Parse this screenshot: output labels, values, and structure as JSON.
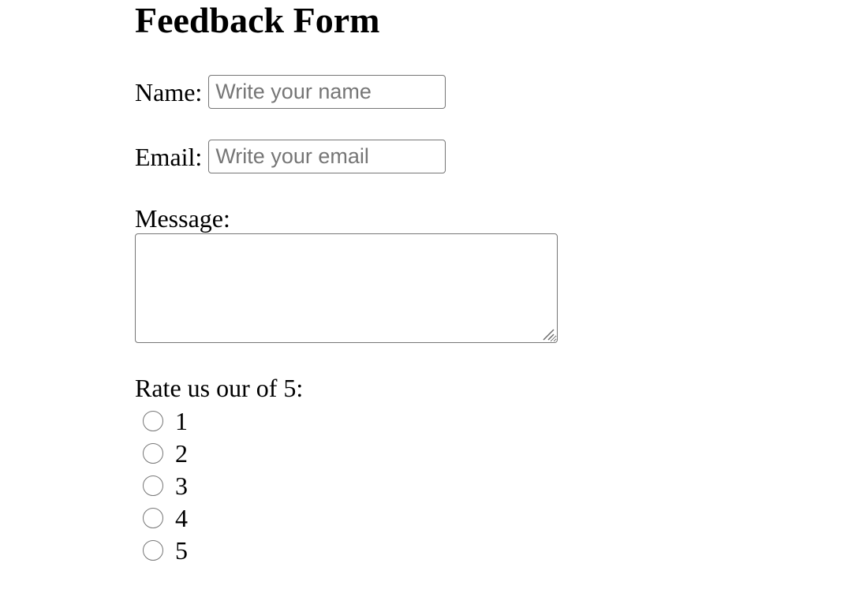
{
  "form": {
    "title": "Feedback Form",
    "name": {
      "label": "Name:",
      "placeholder": "Write your name",
      "value": ""
    },
    "email": {
      "label": "Email:",
      "placeholder": "Write your email",
      "value": ""
    },
    "message": {
      "label": "Message:",
      "value": ""
    },
    "rating": {
      "label": "Rate us our of 5:",
      "options": [
        "1",
        "2",
        "3",
        "4",
        "5"
      ],
      "selected": null
    }
  },
  "icons": {
    "resize_grip": "resize-grip-icon",
    "radio": "radio-unchecked-icon"
  },
  "colors": {
    "border": "#767676",
    "placeholder": "#767676",
    "text": "#000000",
    "background": "#ffffff"
  }
}
